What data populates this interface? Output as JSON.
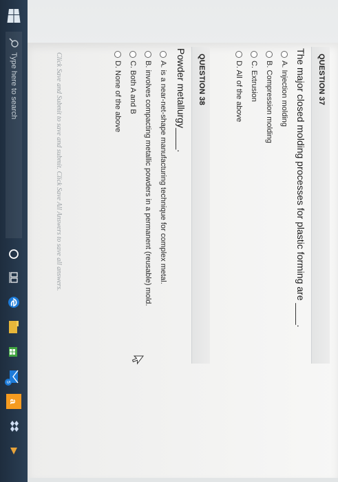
{
  "questions": [
    {
      "label": "QUESTION 37",
      "text": "The major closed molding processes for plastic forming are ____.",
      "options": [
        "A. Injection molding",
        "B. Compression molding",
        "C. Extrusion",
        "D. All of the above"
      ]
    },
    {
      "label": "QUESTION 38",
      "text": "Powder metallurgy____.",
      "options": [
        "A. is a near-net-shape manufacturing technique for complex metal.",
        "B. involves compacting metallic powders in a permanent (reusable) mold.",
        "C. Both A and B",
        "D. None of the above"
      ]
    }
  ],
  "footer_note": "Click Save and Submit to save and submit. Click Save All Answers to save all answers.",
  "taskbar": {
    "search_placeholder": "Type here to search",
    "mail_badge": "5",
    "amazon_label": "a"
  },
  "colors": {
    "taskbar": "#1e2d3e",
    "edge_blue": "#1d7bd8",
    "store_green": "#41a541",
    "amazon_orange": "#f59b20"
  }
}
